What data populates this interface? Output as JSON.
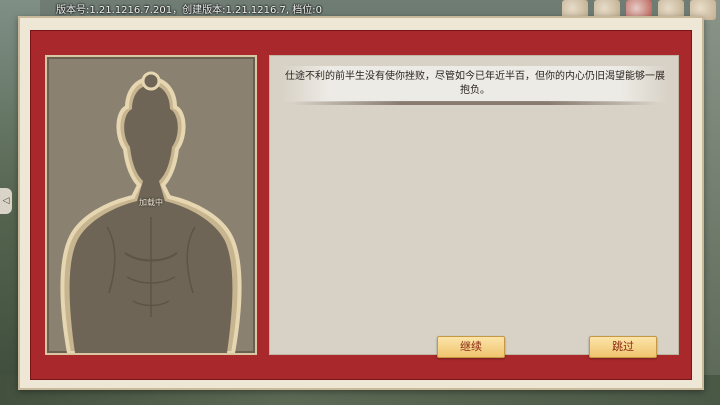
{
  "version_text": "版本号:1.21.1216.7.201，创建版本:1.21.1216.7, 档位:0",
  "figure_label": "加载中",
  "story_text": "仕途不利的前半生没有使你挫败，尽管如今已年近半百，但你的内心仍旧渴望能够一展抱负。",
  "buttons": {
    "continue": "继续",
    "skip": "跳过"
  },
  "side_tab_glyph": "◁",
  "colors": {
    "panel_red": "#a8282b",
    "frame_cream": "#efe7d6",
    "button_gold": "#f0c46f",
    "button_text": "#8a2a12"
  },
  "icons": [
    "avatar-icon",
    "event-icon",
    "mail-icon",
    "notice-icon",
    "menu-icon"
  ]
}
